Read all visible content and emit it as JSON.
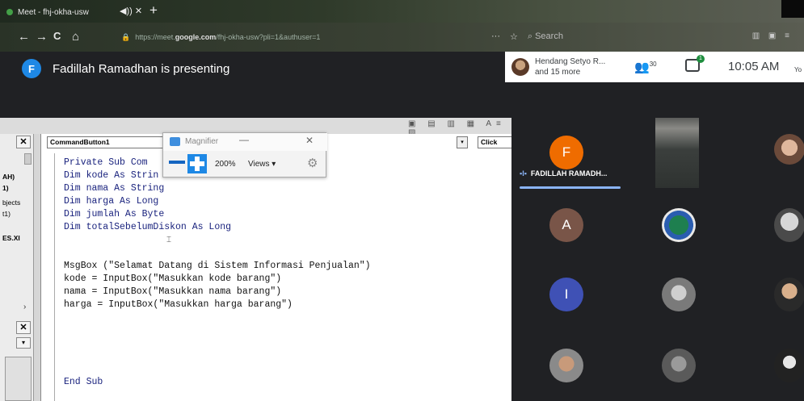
{
  "browser": {
    "tab_title": "Meet - fhj-okha-usw",
    "tab_audio": "◀)) ✕",
    "new_tab": "+",
    "url_prefix": "https://meet.",
    "url_domain": "google.com",
    "url_path": "/fhj-okha-usw?pli=1&authuser=1",
    "search_placeholder": "Search",
    "nav_back": "←",
    "nav_forward": "→",
    "nav_reload": "C",
    "nav_home": "⌂"
  },
  "meet": {
    "presenter_initial": "F",
    "presenting_text": "Fadillah Ramadhan is presenting",
    "participants_preview_line1": "Hendang Setyo R...",
    "participants_preview_line2": "and 15 more",
    "participant_count": "30",
    "chat_badge": "1",
    "time": "10:05 AM",
    "you_tag": "Yo",
    "active_speaker_name": "FADILLAH RAMADH...",
    "colors": {
      "blue_badge": "#1e88e5",
      "orange": "#ef6c00",
      "brown": "#795548",
      "indigo": "#3f51b5",
      "header_bg": "#202124"
    }
  },
  "tiles": [
    {
      "initial": "F",
      "color": "#ef6c00"
    },
    {
      "initial": "A",
      "color": "#795548"
    },
    {
      "initial": "I",
      "color": "#3f51b5"
    }
  ],
  "vb": {
    "object_combo": "CommandButton1",
    "proc_combo": "Click",
    "project_lines": [
      "AH)",
      "1)",
      "bjects",
      "t1)",
      "ES.XI"
    ],
    "code_lines": [
      {
        "text": "Private Sub Com",
        "color": "blue"
      },
      {
        "text": "Dim kode As Strin",
        "color": "blue"
      },
      {
        "text": "Dim nama As String",
        "color": "blue"
      },
      {
        "text": "Dim harga As Long",
        "color": "blue"
      },
      {
        "text": "Dim jumlah As Byte",
        "color": "blue"
      },
      {
        "text": "Dim totalSebelumDiskon As Long",
        "color": "blue"
      },
      {
        "text": "",
        "color": "black"
      },
      {
        "text": "",
        "color": "black"
      },
      {
        "text": "MsgBox (\"Selamat Datang di Sistem Informasi Penjualan\")",
        "color": "black"
      },
      {
        "text": "kode = InputBox(\"Masukkan kode barang\")",
        "color": "black"
      },
      {
        "text": "nama = InputBox(\"Masukkan nama barang\")",
        "color": "black"
      },
      {
        "text": "harga = InputBox(\"Masukkan harga barang\")",
        "color": "black"
      },
      {
        "text": "",
        "color": "black"
      },
      {
        "text": "",
        "color": "black"
      },
      {
        "text": "",
        "color": "black"
      },
      {
        "text": "",
        "color": "black"
      },
      {
        "text": "",
        "color": "black"
      },
      {
        "text": "End Sub",
        "color": "blue"
      }
    ]
  },
  "magnifier": {
    "title": "Magnifier",
    "zoom": "200%",
    "views": "Views ▾"
  }
}
